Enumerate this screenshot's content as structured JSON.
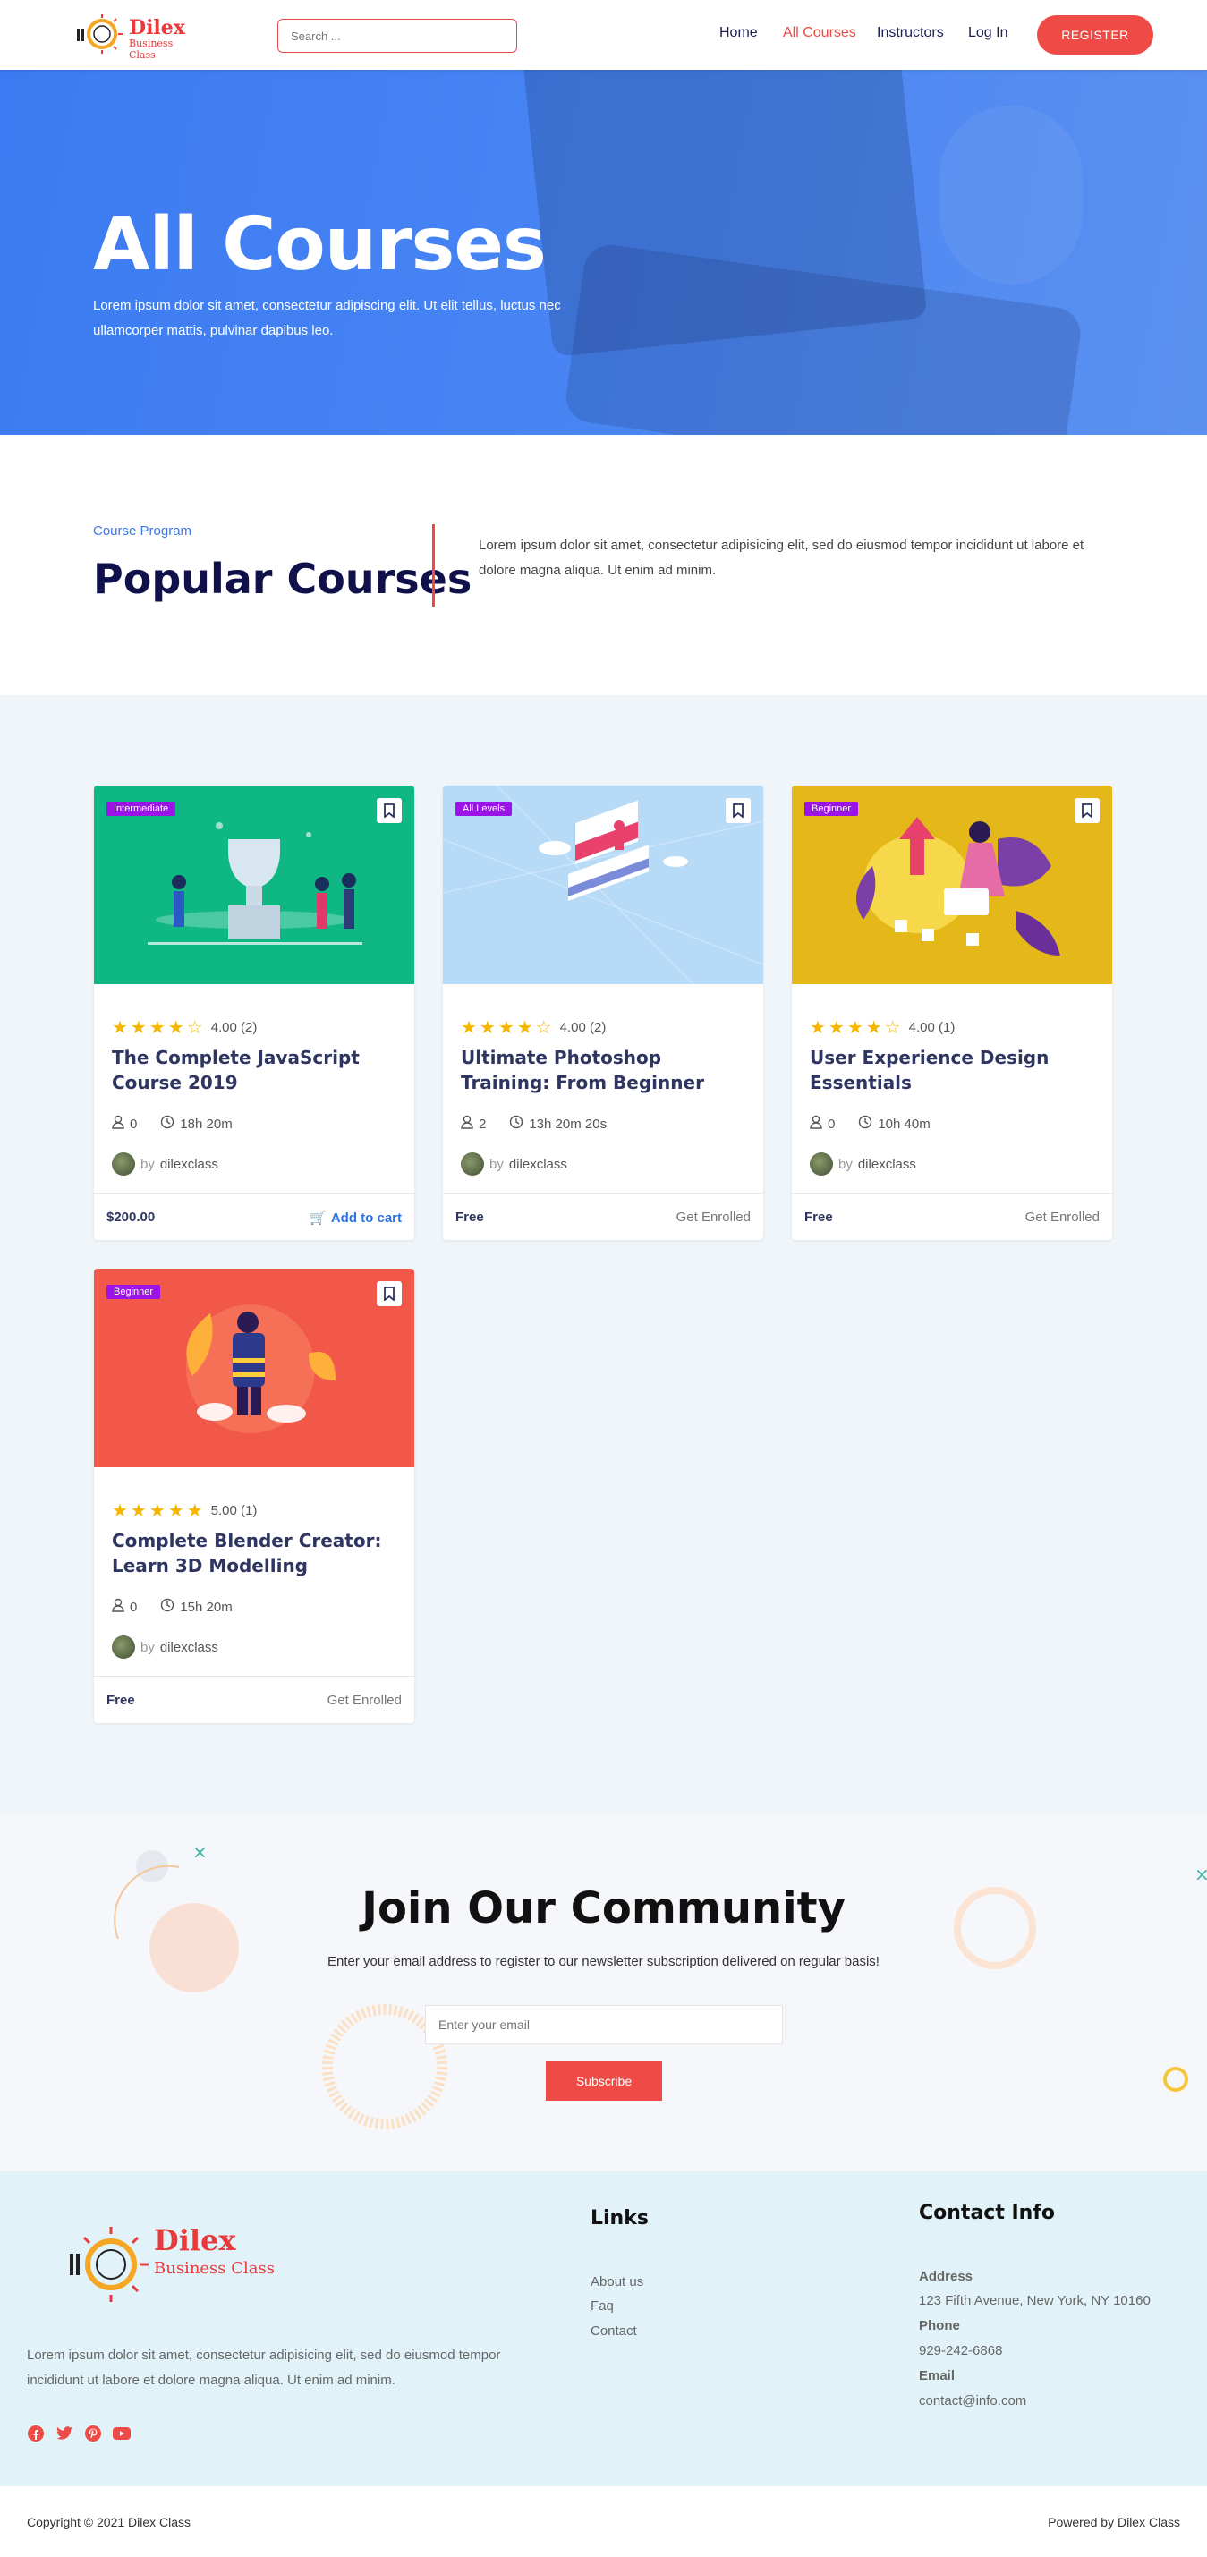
{
  "header": {
    "logo": {
      "name": "Dilex",
      "subtitle": "Business Class"
    },
    "search_placeholder": "Search ...",
    "nav": [
      {
        "label": "Home",
        "active": false
      },
      {
        "label": "All Courses",
        "active": true
      },
      {
        "label": "Instructors",
        "active": false
      },
      {
        "label": "Log In",
        "active": false
      }
    ],
    "register_label": "REGISTER"
  },
  "hero": {
    "title": "All Courses",
    "text": "Lorem ipsum dolor sit amet, consectetur adipiscing elit. Ut elit tellus, luctus nec ullamcorper mattis, pulvinar dapibus leo."
  },
  "popular": {
    "label": "Course Program",
    "title": "Popular Courses",
    "description": "Lorem ipsum dolor sit amet, consectetur adipisicing elit, sed do eiusmod tempor incididunt ut labore et dolore magna aliqua. Ut enim ad minim."
  },
  "courses": [
    {
      "level": "Intermediate",
      "thumb_color": "#0fb783",
      "rating": 4,
      "rating_text": "4.00 (2)",
      "title": "The Complete JavaScript Course 2019",
      "students": "0",
      "duration": "18h 20m",
      "by": "by",
      "author": "dilexclass",
      "price": "$200.00",
      "action": "Add to cart",
      "cart": true
    },
    {
      "level": "All Levels",
      "thumb_color": "#b7daf7",
      "rating": 4,
      "rating_text": "4.00 (2)",
      "title": "Ultimate Photoshop Training: From Beginner",
      "students": "2",
      "duration": "13h 20m 20s",
      "by": "by",
      "author": "dilexclass",
      "price": "Free",
      "action": "Get Enrolled",
      "cart": false
    },
    {
      "level": "Beginner",
      "thumb_color": "#e3b818",
      "rating": 4,
      "rating_text": "4.00 (1)",
      "title": "User Experience Design Essentials",
      "students": "0",
      "duration": "10h 40m",
      "by": "by",
      "author": "dilexclass",
      "price": "Free",
      "action": "Get Enrolled",
      "cart": false
    },
    {
      "level": "Beginner",
      "thumb_color": "#f2584a",
      "rating": 5,
      "rating_text": "5.00 (1)",
      "title": "Complete Blender Creator: Learn 3D Modelling",
      "students": "0",
      "duration": "15h 20m",
      "by": "by",
      "author": "dilexclass",
      "price": "Free",
      "action": "Get Enrolled",
      "cart": false
    }
  ],
  "community": {
    "title": "Join Our Community",
    "text": "Enter your email address to register to our newsletter subscription delivered on regular basis!",
    "email_placeholder": "Enter your email",
    "button": "Subscribe"
  },
  "footer": {
    "logo": {
      "name": "Dilex",
      "subtitle": "Business Class"
    },
    "description": "Lorem ipsum dolor sit amet, consectetur adipisicing elit, sed do eiusmod tempor incididunt ut labore et dolore magna aliqua. Ut enim ad minim.",
    "social": [
      "facebook-icon",
      "twitter-icon",
      "pinterest-icon",
      "youtube-icon"
    ],
    "links_title": "Links",
    "links": [
      "About us",
      "Faq",
      "Contact"
    ],
    "contact_title": "Contact Info",
    "contact": [
      {
        "label": "Address",
        "value": "123 Fifth Avenue, New York, NY 10160"
      },
      {
        "label": "Phone",
        "value": "929-242-6868"
      },
      {
        "label": "Email",
        "value": "contact@info.com"
      }
    ]
  },
  "bottom": {
    "copyright": "Copyright © 2021 Dilex Class",
    "powered": "Powered by Dilex Class"
  },
  "colors": {
    "accent": "#ee4b46",
    "primary_blue": "#3b7af2",
    "heading": "#10104a",
    "badge": "#9b13e6",
    "star": "#f5b600"
  }
}
